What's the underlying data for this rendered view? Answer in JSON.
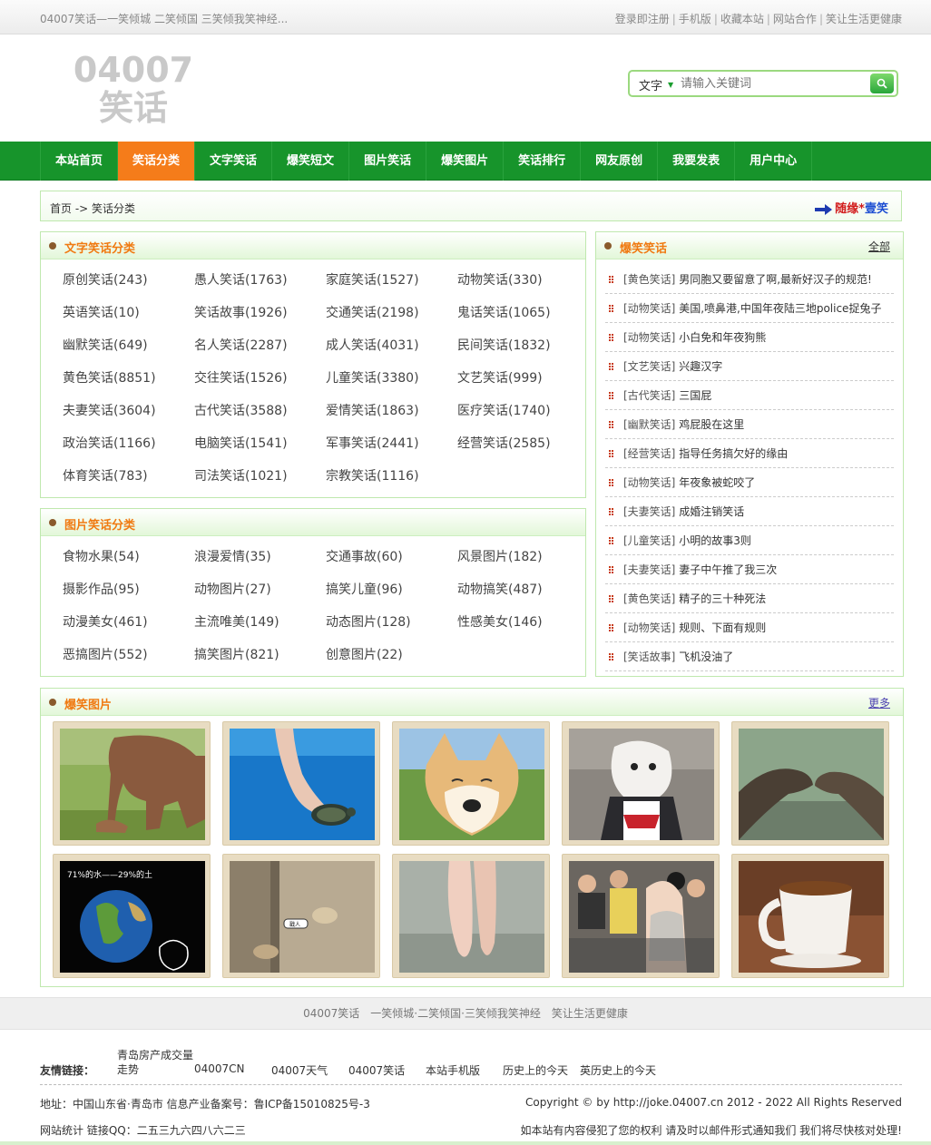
{
  "topbar": {
    "left": "04007笑话—一笑倾城 二笑倾国 三笑倾我笑神经...",
    "links": [
      "登录即注册",
      "手机版",
      "收藏本站",
      "网站合作",
      "笑让生活更健康"
    ]
  },
  "logo": "04007笑话",
  "search": {
    "type": "文字",
    "placeholder": "请输入关键词"
  },
  "nav": [
    "本站首页",
    "笑话分类",
    "文字笑话",
    "爆笑短文",
    "图片笑话",
    "爆笑图片",
    "笑话排行",
    "网友原创",
    "我要发表",
    "用户中心"
  ],
  "nav_active": 1,
  "breadcrumb": {
    "path": "首页 -> 笑话分类",
    "random_1": "随缘",
    "random_star": "*",
    "random_2": "壹笑"
  },
  "text_categories": {
    "title": "文字笑话分类",
    "items": [
      "原创笑话(243)",
      "愚人笑话(1763)",
      "家庭笑话(1527)",
      "动物笑话(330)",
      "英语笑话(10)",
      "笑话故事(1926)",
      "交通笑话(2198)",
      "鬼话笑话(1065)",
      "幽默笑话(649)",
      "名人笑话(2287)",
      "成人笑话(4031)",
      "民间笑话(1832)",
      "黄色笑话(8851)",
      "交往笑话(1526)",
      "儿童笑话(3380)",
      "文艺笑话(999)",
      "夫妻笑话(3604)",
      "古代笑话(3588)",
      "爱情笑话(1863)",
      "医疗笑话(1740)",
      "政治笑话(1166)",
      "电脑笑话(1541)",
      "军事笑话(2441)",
      "经营笑话(2585)",
      "体育笑话(783)",
      "司法笑话(1021)",
      "宗教笑话(1116)"
    ]
  },
  "pic_categories": {
    "title": "图片笑话分类",
    "items": [
      "食物水果(54)",
      "浪漫爱情(35)",
      "交通事故(60)",
      "风景图片(182)",
      "摄影作品(95)",
      "动物图片(27)",
      "搞笑儿童(96)",
      "动物搞笑(487)",
      "动漫美女(461)",
      "主流唯美(149)",
      "动态图片(128)",
      "性感美女(146)",
      "恶搞图片(552)",
      "搞笑图片(821)",
      "创意图片(22)"
    ]
  },
  "hot_jokes": {
    "title": "爆笑笑话",
    "more": "全部",
    "items": [
      {
        "tag": "[黄色笑话]",
        "text": "男同胞又要留意了啊,最新好汉子的规范!"
      },
      {
        "tag": "[动物笑话]",
        "text": "美国,喷鼻港,中国年夜陆三地police捉兔子"
      },
      {
        "tag": "[动物笑话]",
        "text": "小白免和年夜狗熊"
      },
      {
        "tag": "[文艺笑话]",
        "text": "兴趣汉字"
      },
      {
        "tag": "[古代笑话]",
        "text": "三国屁"
      },
      {
        "tag": "[幽默笑话]",
        "text": "鸡屁股在这里"
      },
      {
        "tag": "[经营笑话]",
        "text": "指导任务搞欠好的缘由"
      },
      {
        "tag": "[动物笑话]",
        "text": "年夜象被蛇咬了"
      },
      {
        "tag": "[夫妻笑话]",
        "text": "成婚注销笑话"
      },
      {
        "tag": "[儿童笑话]",
        "text": "小明的故事3则"
      },
      {
        "tag": "[夫妻笑话]",
        "text": "妻子中午推了我三次"
      },
      {
        "tag": "[黄色笑话]",
        "text": "精子的三十种死法"
      },
      {
        "tag": "[动物笑话]",
        "text": "规则、下面有规则"
      },
      {
        "tag": "[笑话故事]",
        "text": "飞机没油了"
      }
    ]
  },
  "hot_pics": {
    "title": "爆笑图片",
    "more": "更多",
    "images": [
      "elephant-photo",
      "turtle-underwater-photo",
      "shiba-dog-photo",
      "cosplay-dog-mask-photo",
      "sea-lions-photo",
      "earth-globe-cartoon-photo",
      "dog-and-cat-photo",
      "legs-photo",
      "crowd-model-photo",
      "coffee-cup-photo"
    ],
    "earth_caption": "71%的水——29%的土",
    "cat_sign": "戳人"
  },
  "footer": {
    "line": [
      "04007笑话",
      "一笑倾城·二笑倾国·三笑倾我笑神经",
      "笑让生活更健康"
    ],
    "links_label": "友情链接：",
    "links": [
      "青岛房产成交量走势",
      "04007CN",
      "04007天气",
      "04007笑话",
      "本站手机版",
      "历史上的今天",
      "英历史上的今天"
    ],
    "address": "地址：中国山东省·青岛市 信息产业备案号：鲁ICP备15010825号-3",
    "copyright": "Copyright © by http://joke.04007.cn 2012 - 2022 All Rights Reserved",
    "stats": "网站统计 链接QQ：二五三九六四八六二三",
    "notice": "如本站有内容侵犯了您的权利 请及时以邮件形式通知我们 我们将尽快核对处理!"
  },
  "colors": {
    "nav_green": "#17942b",
    "active_orange": "#f57c1a",
    "title_orange": "#f07a12",
    "border_green": "#bfe8ae"
  }
}
